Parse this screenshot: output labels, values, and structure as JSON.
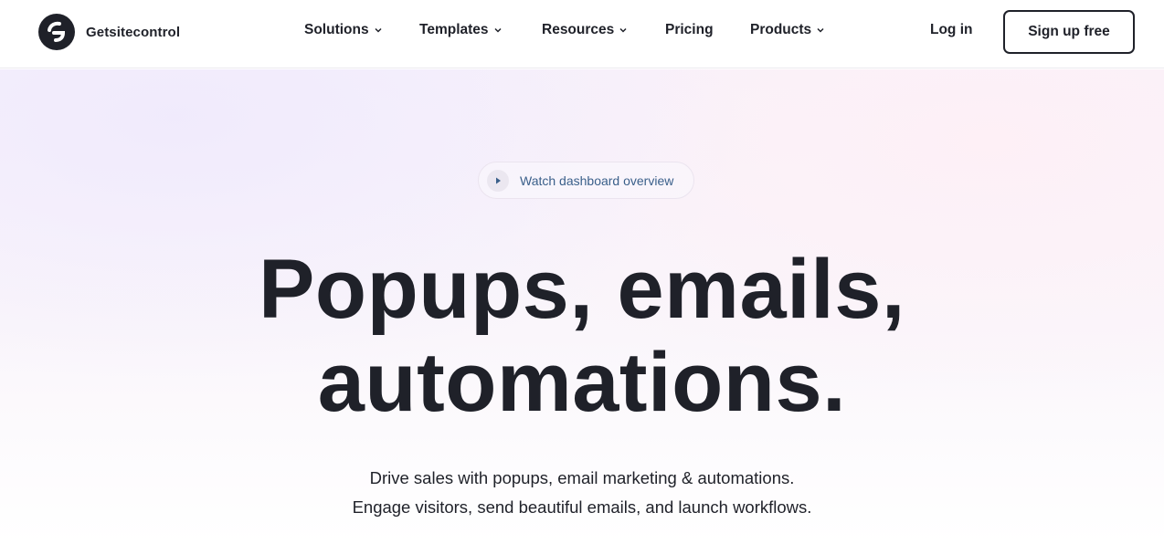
{
  "header": {
    "brand": "Getsitecontrol",
    "nav": [
      {
        "label": "Solutions",
        "has_dropdown": true
      },
      {
        "label": "Templates",
        "has_dropdown": true
      },
      {
        "label": "Resources",
        "has_dropdown": true
      },
      {
        "label": "Pricing",
        "has_dropdown": false
      },
      {
        "label": "Products",
        "has_dropdown": true
      }
    ],
    "login_label": "Log in",
    "signup_label": "Sign up free"
  },
  "hero": {
    "video_link_label": "Watch dashboard overview",
    "video_icon": "play-icon",
    "headline_line1": "Popups, emails,",
    "headline_line2": "automations.",
    "subtitle_line1": "Drive sales with popups, email marketing & automations.",
    "subtitle_line2": "Engage visitors, send beautiful emails, and launch workflows."
  },
  "colors": {
    "text": "#1f2129",
    "link_blue": "#3a5f8a",
    "hero_lilac": "#f3eefb",
    "hero_pink": "#fdf1f6"
  }
}
